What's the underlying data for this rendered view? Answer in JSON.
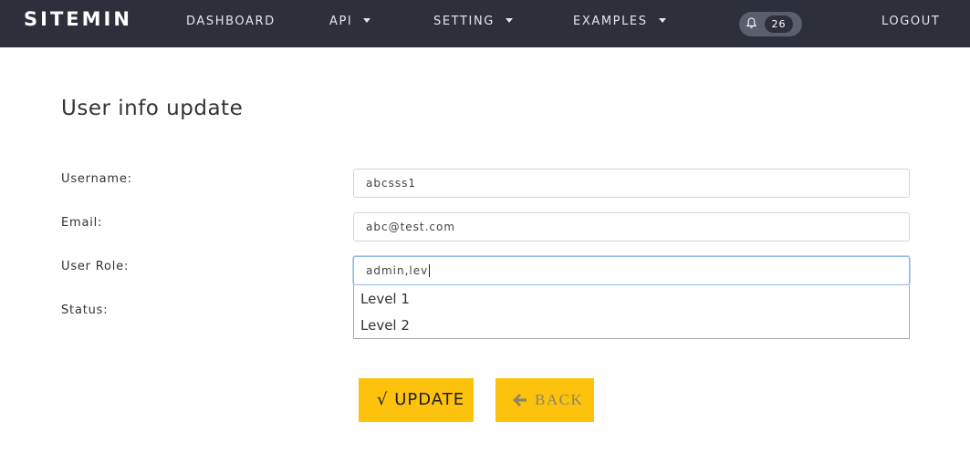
{
  "navbar": {
    "brand": "SITEMIN",
    "items": [
      {
        "label": "DASHBOARD",
        "has_dropdown": false
      },
      {
        "label": "API",
        "has_dropdown": true
      },
      {
        "label": "SETTING",
        "has_dropdown": true
      },
      {
        "label": "EXAMPLES",
        "has_dropdown": true
      }
    ],
    "notifications": {
      "icon": "bell-icon",
      "count": "26"
    },
    "logout": "LOGOUT"
  },
  "form": {
    "title": "User info update",
    "username": {
      "label": "Username:",
      "value": "abcsss1"
    },
    "email": {
      "label": "Email:",
      "value": "abc@test.com"
    },
    "role": {
      "label": "User Role:",
      "value": "admin,lev",
      "suggestions": [
        "Level 1",
        "Level 2"
      ]
    },
    "status": {
      "label": "Status:"
    }
  },
  "actions": {
    "update": {
      "icon": "check-icon",
      "glyph": "√",
      "label": "UPDATE"
    },
    "back": {
      "icon": "arrow-left-icon",
      "label": "BACK"
    }
  },
  "colors": {
    "navbar_bg": "#2d2f3b",
    "accent_button": "#fcc20c",
    "focus_border": "#8eb8ec"
  }
}
